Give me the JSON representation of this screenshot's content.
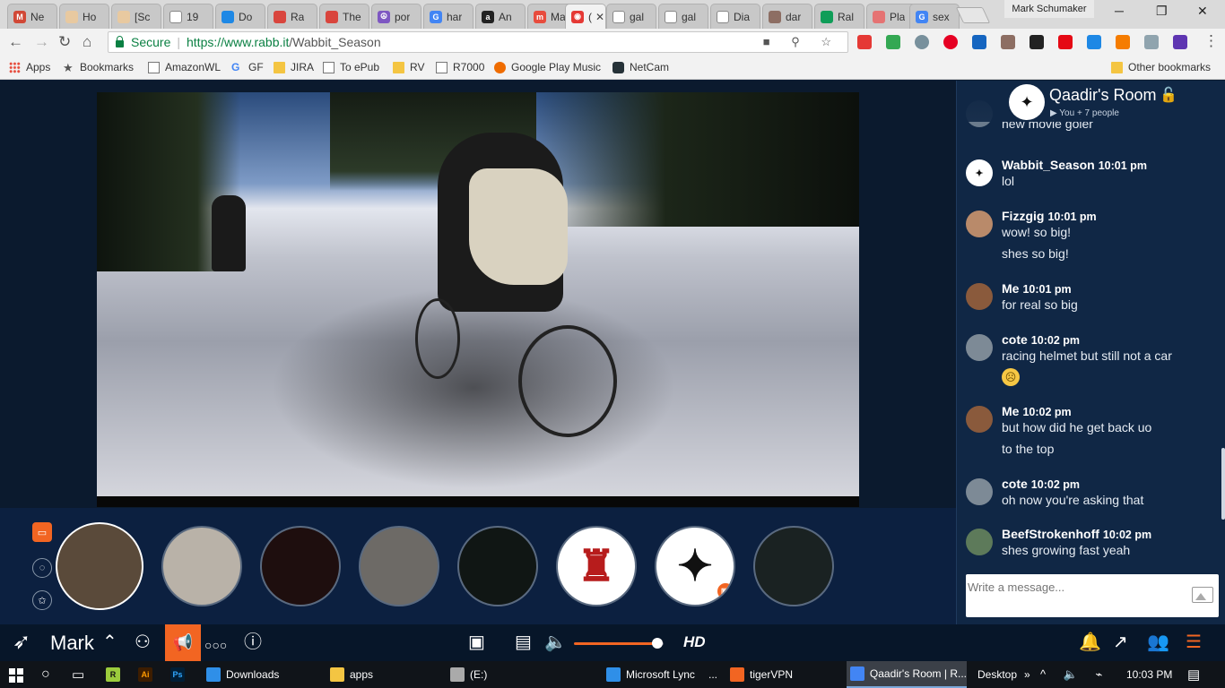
{
  "browser": {
    "tabs": [
      {
        "title": "Ne",
        "color": "#d14836",
        "glyph": "M"
      },
      {
        "title": "Ho",
        "color": "#e8c9a0",
        "glyph": ""
      },
      {
        "title": "[Sc",
        "color": "#e8c9a0",
        "glyph": ""
      },
      {
        "title": "19",
        "color": "#ffffff",
        "glyph": ""
      },
      {
        "title": "Do",
        "color": "#1e88e5",
        "glyph": ""
      },
      {
        "title": "Ra",
        "color": "#d9453d",
        "glyph": ""
      },
      {
        "title": "The",
        "color": "#d9453d",
        "glyph": ""
      },
      {
        "title": "por",
        "color": "#7e57c2",
        "glyph": "☮"
      },
      {
        "title": "har",
        "color": "#4285f4",
        "glyph": "G"
      },
      {
        "title": "An",
        "color": "#222222",
        "glyph": "a"
      },
      {
        "title": "Ma",
        "color": "#e84c3d",
        "glyph": "m"
      },
      {
        "title": "(",
        "color": "#e53935",
        "glyph": "◉",
        "active": true
      },
      {
        "title": "gal",
        "color": "#ffffff",
        "glyph": ""
      },
      {
        "title": "gal",
        "color": "#ffffff",
        "glyph": ""
      },
      {
        "title": "Dia",
        "color": "#ffffff",
        "glyph": ""
      },
      {
        "title": "dar",
        "color": "#8d6e63",
        "glyph": ""
      },
      {
        "title": "Ral",
        "color": "#0f9d58",
        "glyph": ""
      },
      {
        "title": "Pla",
        "color": "#e57373",
        "glyph": ""
      },
      {
        "title": "sex",
        "color": "#4285f4",
        "glyph": "G"
      }
    ],
    "profile_name": "Mark Schumaker",
    "secure_label": "Secure",
    "url_base": "https://www.rabb.it",
    "url_path": "/Wabbit_Season",
    "bookmarks": [
      {
        "label": "Apps",
        "icon": "apps-grid-icon"
      },
      {
        "label": "Bookmarks",
        "icon": "star-icon"
      },
      {
        "label": "AmazonWL",
        "icon": "page-icon"
      },
      {
        "label": "GF",
        "icon": "google-icon"
      },
      {
        "label": "JIRA",
        "icon": "folder-icon"
      },
      {
        "label": "To ePub",
        "icon": "epub-icon"
      },
      {
        "label": "RV",
        "icon": "folder-icon"
      },
      {
        "label": "R7000",
        "icon": "page-icon"
      },
      {
        "label": "Google Play Music",
        "icon": "play-music-icon"
      },
      {
        "label": "NetCam",
        "icon": "camera-icon"
      }
    ],
    "other_bookmarks": "Other bookmarks"
  },
  "room": {
    "title": "Qaadir's Room",
    "subtitle": "▶ You + 7 people"
  },
  "chat": {
    "messages": [
      {
        "name": "",
        "time": "",
        "lines": [
          "new movie goier"
        ],
        "avatar_color": "#6b7b8c"
      },
      {
        "name": "Wabbit_Season",
        "time": "10:01 pm",
        "lines": [
          "lol"
        ],
        "avatar_color": "#ffffff"
      },
      {
        "name": "Fizzgig",
        "time": "10:01 pm",
        "lines": [
          "wow! so big!",
          "shes so big!"
        ],
        "avatar_color": "#b98a6a"
      },
      {
        "name": "Me",
        "time": "10:01 pm",
        "lines": [
          "for real so big"
        ],
        "avatar_color": "#8a5a3c"
      },
      {
        "name": "cote",
        "time": "10:02 pm",
        "lines": [
          "racing helmet but still not a car"
        ],
        "avatar_color": "#7d8a96",
        "emoji": "☹"
      },
      {
        "name": "Me",
        "time": "10:02 pm",
        "lines": [
          "but how did he get back uo",
          "to the top"
        ],
        "avatar_color": "#8a5a3c"
      },
      {
        "name": "cote",
        "time": "10:02 pm",
        "lines": [
          "oh now you're asking that"
        ],
        "avatar_color": "#7d8a96"
      },
      {
        "name": "BeefStrokenhoff",
        "time": "10:02 pm",
        "lines": [
          "shes growing fast yeah"
        ],
        "avatar_color": "#5d7a5a"
      }
    ],
    "composer_placeholder": "Write a message..."
  },
  "participants": [
    {
      "bg": "#5a4a3a",
      "border": "#ffffff"
    },
    {
      "bg": "#b9b2a8",
      "border": "#5a6a80"
    },
    {
      "bg": "#1e0e0e",
      "border": "#5a6a80"
    },
    {
      "bg": "#6d6a66",
      "border": "#5a6a80"
    },
    {
      "bg": "#101614",
      "border": "#5a6a80"
    },
    {
      "bg": "#ffffff",
      "border": "#5a6a80",
      "glyph": "♜",
      "glyph_color": "#b71c1c"
    },
    {
      "bg": "#ffffff",
      "border": "#5a6a80",
      "glyph": "✦",
      "glyph_color": "#111111",
      "badge": true
    },
    {
      "bg": "#1a2222",
      "border": "#5a6a80"
    }
  ],
  "controls": {
    "user_name": "Mark",
    "quality": "HD",
    "volume": 0.93
  },
  "taskbar": {
    "items": [
      {
        "label": "Downloads",
        "icon_color": "#2f8fe8"
      },
      {
        "label": "apps",
        "icon_color": "#f4c542"
      },
      {
        "label": "(E:)",
        "icon_color": "#aaaaaa"
      },
      {
        "label": "Microsoft Lync",
        "icon_color": "#2f8fe8"
      },
      {
        "label": "...",
        "icon_color": "#101419"
      },
      {
        "label": "tigerVPN",
        "icon_color": "#f26522"
      },
      {
        "label": "Qaadir's Room | R...",
        "icon_color": "#4285f4"
      }
    ],
    "desktop_label": "Desktop",
    "clock": "10:03 PM"
  },
  "colors": {
    "accent": "#f26522",
    "panel": "#102745",
    "page_bg": "#0b1a2e"
  }
}
